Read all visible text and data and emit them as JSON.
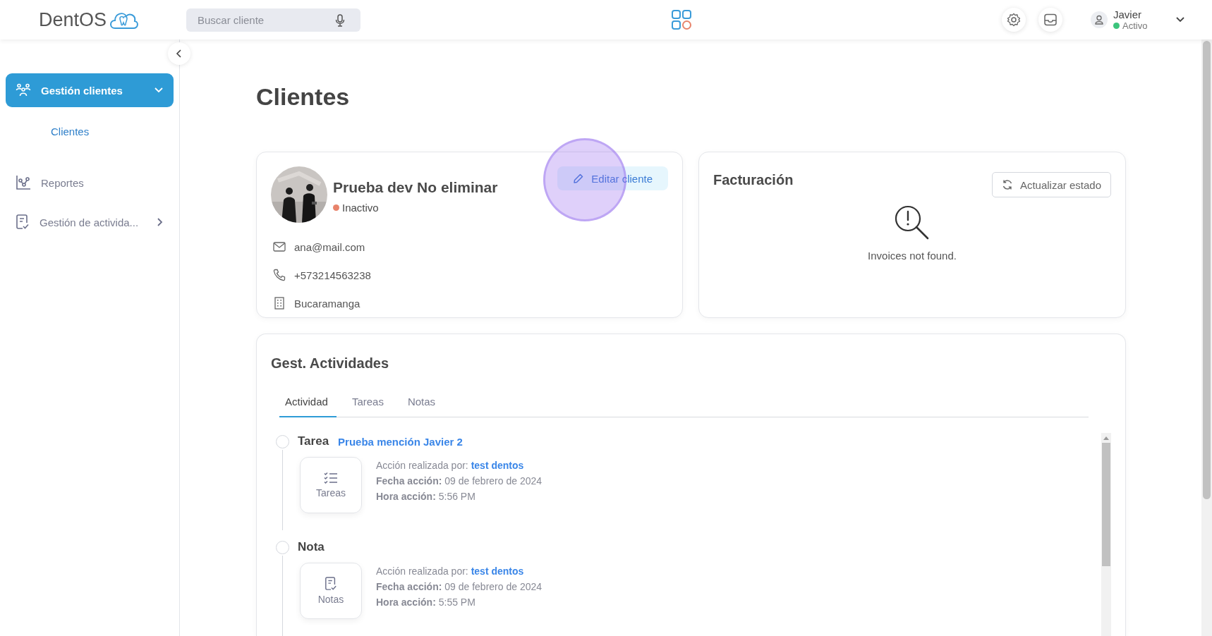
{
  "header": {
    "logo": "DentOS",
    "search": {
      "placeholder": "Buscar cliente"
    },
    "user": {
      "name": "Javier",
      "status": {
        "label": "Activo",
        "color": "#3cc47c"
      }
    }
  },
  "sidebar": {
    "items": [
      {
        "kind": "clients",
        "label": "Gestión clientes",
        "selected": true,
        "expanded": true,
        "children": [
          {
            "label": "Clientes",
            "selected": true
          }
        ]
      },
      {
        "kind": "reports",
        "label": "Reportes",
        "selected": false
      },
      {
        "kind": "activities",
        "label": "Gestión de activida...",
        "selected": false,
        "expanded": false
      }
    ]
  },
  "page_title": "Clientes",
  "client": {
    "name": "Prueba dev No eliminar",
    "status": {
      "label": "Inactivo",
      "color": "#e8836b"
    },
    "edit_button": "Editar cliente",
    "contacts": [
      {
        "kind": "email",
        "text": "ana@mail.com"
      },
      {
        "kind": "phone",
        "text": "+573214563238"
      },
      {
        "kind": "city",
        "text": "Bucaramanga"
      }
    ]
  },
  "billing": {
    "title": "Facturación",
    "button": "Actualizar estado",
    "empty_message": "Invoices not found."
  },
  "activities": {
    "title": "Gest. Actividades",
    "tabs": [
      {
        "label": "Actividad",
        "selected": true
      },
      {
        "label": "Tareas",
        "selected": false
      },
      {
        "label": "Notas",
        "selected": false
      }
    ],
    "entries": [
      {
        "kind": "task",
        "type": "Tarea",
        "link": "Prueba mención Javier 2",
        "badge": "Tareas",
        "by_label": "Acción realizada por:",
        "by": "test dentos",
        "date_label": "Fecha acción:",
        "date": "09 de febrero de 2024",
        "time_label": "Hora acción:",
        "time": "5:56 PM"
      },
      {
        "kind": "note",
        "type": "Nota",
        "badge": "Notas",
        "by_label": "Acción realizada por:",
        "by": "test dentos",
        "date_label": "Fecha acción:",
        "date": "09 de febrero de 2024",
        "time_label": "Hora acción:",
        "time": "5:55 PM"
      }
    ]
  }
}
